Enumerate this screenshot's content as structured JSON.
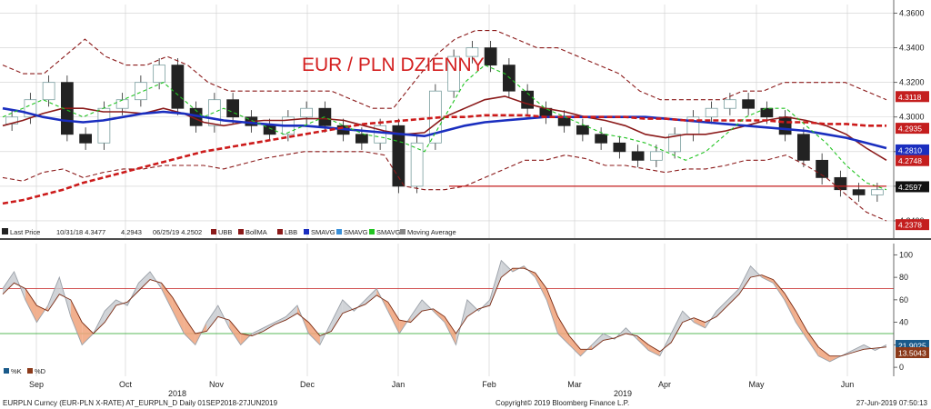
{
  "chart_data": [
    {
      "type": "candlestick",
      "title": "EUR / PLN DZIENNY",
      "ylim": [
        4.23,
        4.365
      ],
      "y_ticks": [
        "4.3600",
        "4.3400",
        "4.3200",
        "4.3000",
        "4.2800",
        "4.2600",
        "4.2400"
      ],
      "x_ticks": [
        "Sep",
        "Oct",
        "Nov",
        "Dec",
        "Jan",
        "Feb",
        "Mar",
        "Apr",
        "May",
        "Jun"
      ],
      "x_years": [
        "2018",
        "2019"
      ],
      "support_level": 4.26,
      "ohlc_close_sample": [
        4.3,
        4.31,
        4.32,
        4.29,
        4.285,
        4.305,
        4.31,
        4.32,
        4.33,
        4.305,
        4.295,
        4.31,
        4.3,
        4.295,
        4.29,
        4.3,
        4.305,
        4.295,
        4.29,
        4.285,
        4.295,
        4.26,
        4.285,
        4.315,
        4.335,
        4.34,
        4.33,
        4.315,
        4.305,
        4.3,
        4.295,
        4.29,
        4.285,
        4.28,
        4.275,
        4.28,
        4.29,
        4.3,
        4.305,
        4.31,
        4.305,
        4.3,
        4.29,
        4.275,
        4.265,
        4.258,
        4.255,
        4.258
      ],
      "series": [
        {
          "name": "UBB",
          "style": "dashed",
          "color": "#8b1a1a",
          "values": [
            4.33,
            4.325,
            4.325,
            4.335,
            4.345,
            4.335,
            4.33,
            4.33,
            4.335,
            4.33,
            4.32,
            4.315,
            4.315,
            4.315,
            4.315,
            4.315,
            4.315,
            4.31,
            4.305,
            4.305,
            4.32,
            4.335,
            4.345,
            4.35,
            4.35,
            4.345,
            4.34,
            4.34,
            4.335,
            4.33,
            4.325,
            4.315,
            4.31,
            4.31,
            4.31,
            4.31,
            4.315,
            4.315,
            4.32,
            4.32,
            4.32,
            4.32,
            4.315,
            4.31
          ]
        },
        {
          "name": "BollMA",
          "style": "solid",
          "color": "#8b1a1a",
          "values": [
            4.295,
            4.298,
            4.302,
            4.305,
            4.305,
            4.303,
            4.303,
            4.302,
            4.305,
            4.302,
            4.297,
            4.295,
            4.297,
            4.298,
            4.298,
            4.299,
            4.299,
            4.298,
            4.295,
            4.292,
            4.29,
            4.291,
            4.3,
            4.305,
            4.31,
            4.312,
            4.308,
            4.305,
            4.303,
            4.3,
            4.298,
            4.295,
            4.29,
            4.288,
            4.29,
            4.29,
            4.292,
            4.295,
            4.298,
            4.3,
            4.298,
            4.295,
            4.29,
            4.282,
            4.275
          ]
        },
        {
          "name": "LBB",
          "style": "dashed",
          "color": "#8b1a1a",
          "values": [
            4.265,
            4.263,
            4.268,
            4.27,
            4.265,
            4.268,
            4.27,
            4.27,
            4.272,
            4.272,
            4.272,
            4.27,
            4.273,
            4.276,
            4.278,
            4.28,
            4.28,
            4.28,
            4.28,
            4.278,
            4.26,
            4.258,
            4.258,
            4.26,
            4.265,
            4.27,
            4.275,
            4.275,
            4.278,
            4.276,
            4.272,
            4.272,
            4.27,
            4.268,
            4.27,
            4.27,
            4.272,
            4.275,
            4.275,
            4.278,
            4.272,
            4.265,
            4.255,
            4.245,
            4.24
          ]
        },
        {
          "name": "SMAVG",
          "style": "solid",
          "color": "#1a2ebf",
          "values": [
            4.305,
            4.303,
            4.3,
            4.298,
            4.297,
            4.298,
            4.3,
            4.302,
            4.303,
            4.302,
            4.3,
            4.298,
            4.297,
            4.296,
            4.295,
            4.295,
            4.294,
            4.293,
            4.292,
            4.291,
            4.29,
            4.289,
            4.292,
            4.295,
            4.297,
            4.298,
            4.299,
            4.3,
            4.3,
            4.3,
            4.3,
            4.3,
            4.3,
            4.299,
            4.298,
            4.297,
            4.296,
            4.295,
            4.294,
            4.293,
            4.292,
            4.29,
            4.288,
            4.285,
            4.282
          ]
        },
        {
          "name": "SMAVG",
          "style": "dashed",
          "color": "#cc1a1a",
          "values": [
            4.25,
            4.252,
            4.255,
            4.258,
            4.262,
            4.265,
            4.268,
            4.271,
            4.274,
            4.277,
            4.28,
            4.282,
            4.284,
            4.286,
            4.288,
            4.29,
            4.292,
            4.294,
            4.296,
            4.297,
            4.298,
            4.299,
            4.3,
            4.3,
            4.301,
            4.301,
            4.301,
            4.3,
            4.3,
            4.3,
            4.3,
            4.3,
            4.299,
            4.299,
            4.298,
            4.298,
            4.298,
            4.298,
            4.298,
            4.297,
            4.297,
            4.296,
            4.296,
            4.295,
            4.295
          ]
        },
        {
          "name": "Moving Average",
          "style": "dashed",
          "color": "#22c422",
          "values": [
            4.3,
            4.305,
            4.31,
            4.305,
            4.3,
            4.305,
            4.31,
            4.315,
            4.32,
            4.31,
            4.3,
            4.305,
            4.3,
            4.295,
            4.29,
            4.295,
            4.3,
            4.295,
            4.29,
            4.288,
            4.285,
            4.28,
            4.3,
            4.32,
            4.33,
            4.325,
            4.315,
            4.305,
            4.3,
            4.295,
            4.29,
            4.288,
            4.285,
            4.28,
            4.275,
            4.28,
            4.29,
            4.3,
            4.305,
            4.305,
            4.295,
            4.285,
            4.272,
            4.262,
            4.258
          ]
        }
      ],
      "price_tags": [
        {
          "label": "4.3118",
          "value": 4.3118,
          "color": "#c41e1e"
        },
        {
          "label": "4.2935",
          "value": 4.2935,
          "color": "#c41e1e"
        },
        {
          "label": "4.2810",
          "value": 4.281,
          "color": "#1a2ebf"
        },
        {
          "label": "4.2748",
          "value": 4.2748,
          "color": "#c41e1e"
        },
        {
          "label": "4.2597",
          "value": 4.2597,
          "color": "#111111"
        },
        {
          "label": "4.2378",
          "value": 4.2378,
          "color": "#c41e1e"
        }
      ]
    },
    {
      "type": "line",
      "ylim": [
        -8,
        110
      ],
      "y_ticks": [
        "100",
        "80",
        "60",
        "40",
        "20",
        "0"
      ],
      "levels": [
        70,
        30
      ],
      "series": [
        {
          "name": "%K",
          "color": "#9aa0a8",
          "values": [
            70,
            85,
            60,
            40,
            55,
            80,
            45,
            20,
            30,
            50,
            60,
            55,
            75,
            85,
            70,
            50,
            30,
            20,
            40,
            55,
            35,
            20,
            30,
            35,
            40,
            45,
            55,
            30,
            20,
            40,
            60,
            50,
            60,
            70,
            50,
            30,
            45,
            60,
            50,
            40,
            20,
            60,
            50,
            60,
            95,
            85,
            90,
            80,
            60,
            30,
            20,
            10,
            20,
            30,
            25,
            35,
            25,
            15,
            10,
            30,
            50,
            40,
            35,
            50,
            60,
            70,
            90,
            80,
            75,
            60,
            40,
            25,
            10,
            5,
            10,
            15,
            20,
            15,
            20
          ]
        },
        {
          "name": "%D",
          "color": "#7a2a12",
          "values": [
            65,
            75,
            70,
            55,
            50,
            65,
            60,
            40,
            30,
            40,
            55,
            58,
            68,
            78,
            75,
            62,
            45,
            30,
            32,
            45,
            42,
            30,
            28,
            32,
            38,
            42,
            48,
            40,
            28,
            32,
            48,
            52,
            56,
            64,
            58,
            42,
            40,
            50,
            52,
            45,
            30,
            45,
            52,
            55,
            80,
            88,
            88,
            84,
            70,
            45,
            28,
            16,
            16,
            24,
            26,
            30,
            28,
            20,
            14,
            22,
            40,
            44,
            40,
            45,
            55,
            65,
            80,
            82,
            78,
            66,
            50,
            32,
            18,
            10,
            10,
            13,
            16,
            17,
            18
          ]
        }
      ],
      "value_tags": [
        {
          "label": "21.9025",
          "color": "#1a5a8a"
        },
        {
          "label": "13.5043",
          "color": "#8b3a1a"
        }
      ]
    }
  ],
  "legend": {
    "last_price_label": "Last Price",
    "high_label": "10/31/18 4.3477",
    "avg_label": "4.2943",
    "low_label": "06/25/19 4.2502",
    "items": [
      "UBB",
      "BollMA",
      "LBB",
      "SMAVG",
      "SMAVG",
      "SMAVG",
      "Moving Average"
    ]
  },
  "sub_legend": [
    "%K",
    "%D"
  ],
  "footer": {
    "left": "EURPLN Curncy (EUR-PLN X-RATE) AT_EURPLN_D  Daily 01SEP2018-27JUN2019",
    "center": "Copyright© 2019 Bloomberg Finance L.P.",
    "right": "27-Jun-2019 07:50:13"
  },
  "colors": {
    "grid": "#cfcfcf",
    "up": "#7a9e9f",
    "down": "#222222",
    "support": "#c41e1e",
    "k_fill": "#c9ccd1",
    "d_fill": "#f0a27a"
  }
}
